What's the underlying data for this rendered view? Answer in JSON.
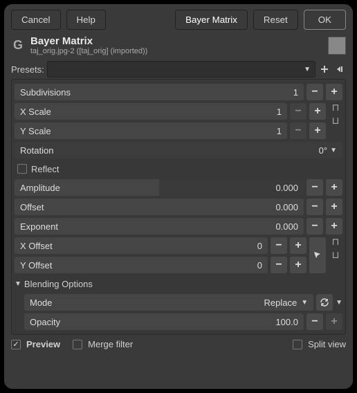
{
  "buttons": {
    "cancel": "Cancel",
    "help": "Help",
    "bayer": "Bayer Matrix",
    "reset": "Reset",
    "ok": "OK"
  },
  "header": {
    "title": "Bayer Matrix",
    "subtitle": "taj_orig.jpg-2 ([taj_orig] (imported))"
  },
  "presets_label": "Presets:",
  "params": {
    "subdivisions": {
      "label": "Subdivisions",
      "value": "1"
    },
    "xscale": {
      "label": "X Scale",
      "value": "1"
    },
    "yscale": {
      "label": "Y Scale",
      "value": "1"
    },
    "rotation": {
      "label": "Rotation",
      "value": "0°"
    },
    "reflect": {
      "label": "Reflect"
    },
    "amplitude": {
      "label": "Amplitude",
      "value": "0.000"
    },
    "offset": {
      "label": "Offset",
      "value": "0.000"
    },
    "exponent": {
      "label": "Exponent",
      "value": "0.000"
    },
    "xoffset": {
      "label": "X Offset",
      "value": "0"
    },
    "yoffset": {
      "label": "Y Offset",
      "value": "0"
    },
    "blending": "Blending Options",
    "mode": {
      "label": "Mode",
      "value": "Replace"
    },
    "opacity": {
      "label": "Opacity",
      "value": "100.0"
    }
  },
  "footer": {
    "preview": "Preview",
    "merge": "Merge filter",
    "split": "Split view"
  }
}
